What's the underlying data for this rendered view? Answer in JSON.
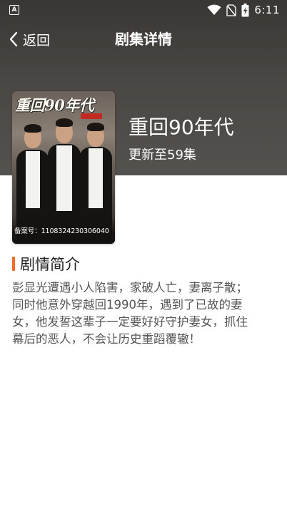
{
  "status_bar": {
    "notification_icon": "a-notification-icon",
    "notification_glyph": "A",
    "icons": [
      "wifi-icon",
      "no-sim-icon",
      "battery-charging-icon"
    ],
    "time": "6:11"
  },
  "header": {
    "back_label": "返回",
    "title": "剧集详情"
  },
  "drama": {
    "name": "重回90年代",
    "update_status": "更新至59集",
    "poster": {
      "title_art": "重回90年代",
      "record_number": "备案号：1108324230306040"
    }
  },
  "synopsis_section": {
    "title": "剧情简介",
    "lines": [
      "彭显光遭遇小人陷害，家破人亡，妻离子散；",
      "同时他意外穿越回1990年，遇到了已故的妻",
      "女，他发誓这辈子一定要好好守护妻女，抓住",
      "幕后的恶人，不会让历史重蹈覆辙！"
    ]
  },
  "colors": {
    "header_bg": "#4a4643",
    "accent": "#f36b2a",
    "body_text": "#555555",
    "title_text": "#222222"
  }
}
